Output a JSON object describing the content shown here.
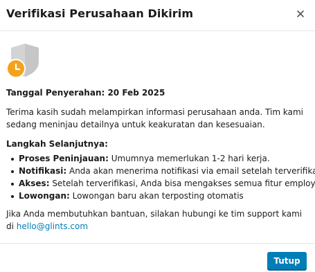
{
  "dialog": {
    "title": "Verifikasi Perusahaan Dikirim",
    "close_icon": "close-icon"
  },
  "status": {
    "shield_icon": "shield-icon",
    "clock_icon": "clock-icon",
    "accent_color": "#f4a21c"
  },
  "submission": {
    "date_label": "Tanggal Penyerahan: 20 Feb 2025"
  },
  "intro_text": "Terima kasih sudah melampirkan informasi perusahaan anda. Tim kami sedang meninjau detailnya untuk keakuratan dan kesesuaian.",
  "next_steps": {
    "title": "Langkah Selanjutnya:",
    "items": [
      {
        "label": "Proses Peninjauan:",
        "text": " Umumnya memerlukan 1-2 hari kerja."
      },
      {
        "label": "Notifikasi:",
        "text": " Anda akan menerima notifikasi via email setelah terverifikasi."
      },
      {
        "label": "Akses:",
        "text": " Setelah terverifikasi, Anda bisa mengakses semua fitur employer."
      },
      {
        "label": "Lowongan:",
        "text": " Lowongan baru akan terposting otomatis"
      }
    ]
  },
  "help": {
    "text": "Jika Anda membutuhkan bantuan, silakan hubungi ke tim support kami di ",
    "email": "hello@glints.com"
  },
  "footer": {
    "close_button_label": "Tutup",
    "button_color": "#017eb7"
  }
}
